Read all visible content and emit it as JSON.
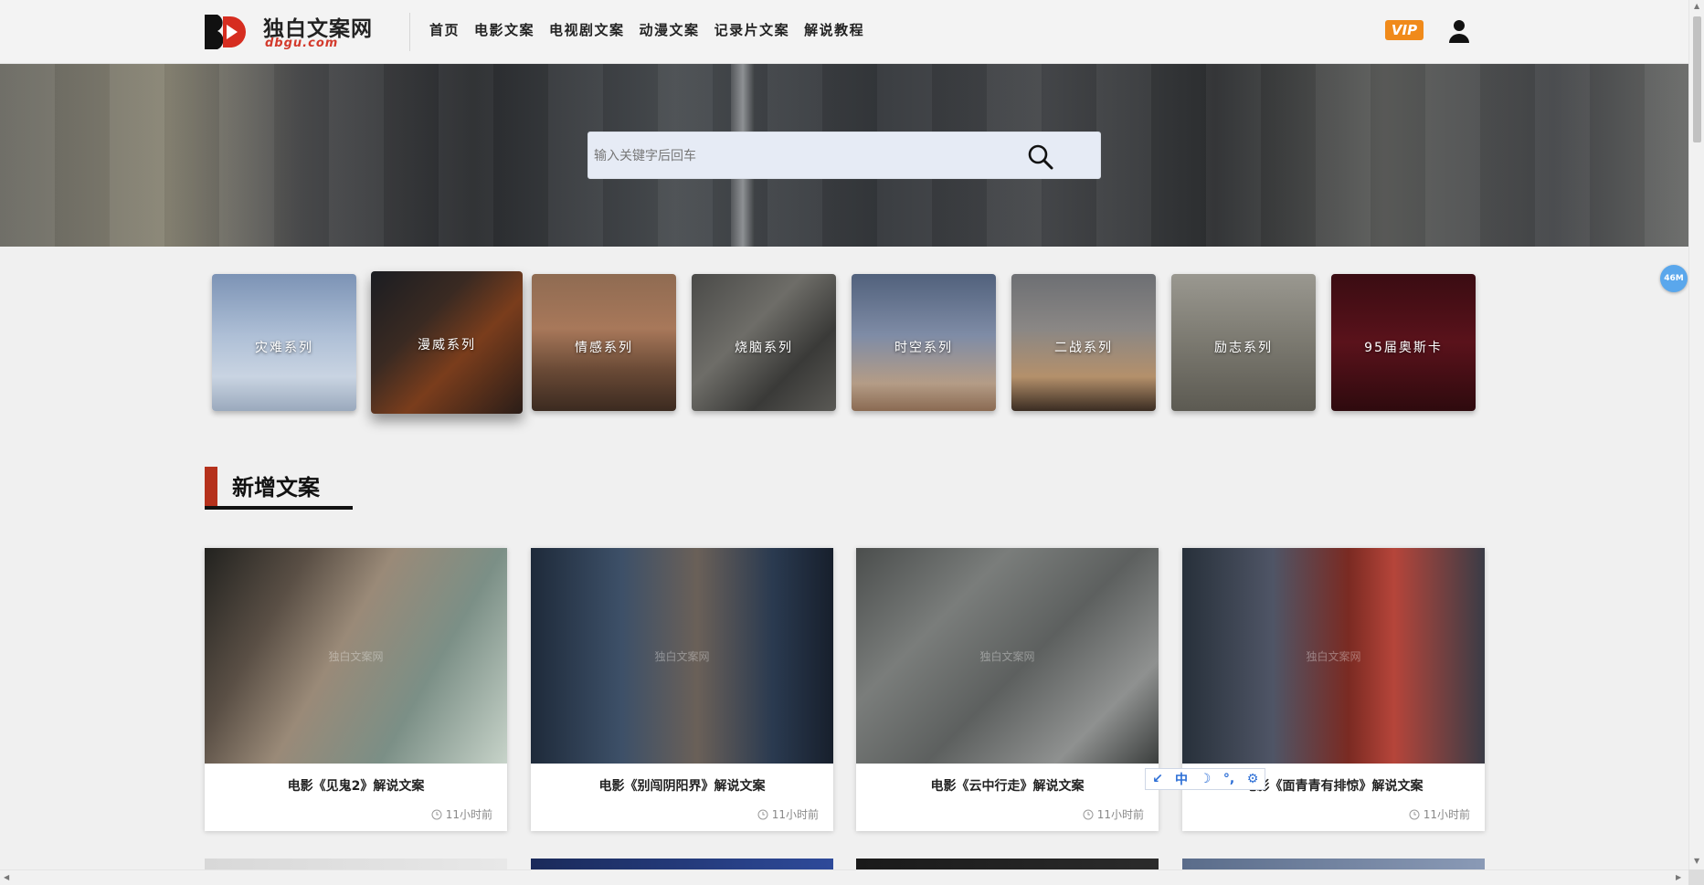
{
  "brand": {
    "name": "独白文案网",
    "domain": "dbgu.com"
  },
  "nav": {
    "items": [
      "首页",
      "电影文案",
      "电视剧文案",
      "动漫文案",
      "记录片文案",
      "解说教程"
    ]
  },
  "header": {
    "vip_label": "VIP"
  },
  "search": {
    "placeholder": "输入关键字后回车"
  },
  "categories": [
    {
      "label": "灾难系列",
      "bg": "linear-gradient(180deg,#7c93b5 0%,#aebfd6 45%,#c9d4e2 75%,#9aa9bd 100%)"
    },
    {
      "label": "漫威系列",
      "bg": "linear-gradient(135deg,#1b1d22 0%,#3a2a22 35%,#7a3d1c 60%,#2a1d18 100%)"
    },
    {
      "label": "情感系列",
      "bg": "linear-gradient(180deg,#8f6b52 0%,#a8785a 40%,#6a4a36 70%,#3b2a20 100%)"
    },
    {
      "label": "烧脑系列",
      "bg": "linear-gradient(135deg,#4a4a48 0%,#6e6d68 40%,#3a3a38 70%,#5a5955 100%)"
    },
    {
      "label": "时空系列",
      "bg": "linear-gradient(180deg,#51617c 0%,#7f8ca6 45%,#b49c86 80%,#8a6a52 100%)"
    },
    {
      "label": "二战系列",
      "bg": "linear-gradient(180deg,#6d6f73 0%,#8a8785 40%,#b4906b 75%,#3a2c22 100%)"
    },
    {
      "label": "励志系列",
      "bg": "linear-gradient(180deg,#9a9890 0%,#7b7970 50%,#5c5a52 100%)"
    },
    {
      "label": "95届奥斯卡",
      "bg": "linear-gradient(180deg,#3a0c12 0%,#5a121b 50%,#2e0a0e 100%)"
    }
  ],
  "section": {
    "title": "新增文案"
  },
  "articles": [
    {
      "title": "电影《见鬼2》解说文案",
      "time": "11小时前",
      "bg": "linear-gradient(120deg,#22221f 0%,#5a4f45 25%,#9a8a78 45%,#7b8f86 70%,#c7d3c9 100%)"
    },
    {
      "title": "电影《别闯阴阳界》解说文案",
      "time": "11小时前",
      "bg": "linear-gradient(90deg,#1e2a3a 0%,#3d5068 30%,#6a6058 55%,#2a3a50 80%,#171f2c 100%)"
    },
    {
      "title": "电影《云中行走》解说文案",
      "time": "11小时前",
      "bg": "linear-gradient(135deg,#4b4e4d 0%,#7a7d7b 30%,#5d605f 55%,#8f9190 80%,#3b3e3d 100%)"
    },
    {
      "title": "电影《面青青有排惊》解说文案",
      "time": "11小时前",
      "bg": "linear-gradient(90deg,#27303a 0%,#4f5566 30%,#7a2a22 55%,#b6453a 70%,#3a3c46 100%)"
    }
  ],
  "articles_row2": [
    {
      "bg": "linear-gradient(90deg,#d8d8d8,#e8e8e8)"
    },
    {
      "bg": "linear-gradient(90deg,#1a2a5a,#2e4a9a)"
    },
    {
      "bg": "linear-gradient(90deg,#1a1a1a,#2b2b2b)"
    },
    {
      "bg": "linear-gradient(90deg,#5a6c8a,#8a9ab6)"
    }
  ],
  "watermark": "独白文案网",
  "ime": {
    "items": [
      "↙",
      "中",
      "☽",
      "°,",
      "⚙"
    ]
  },
  "float_badge": "46M",
  "colors": {
    "accent_red": "#b5311c",
    "vip_orange": "#f08a1a",
    "badge_blue": "#5aa7ec",
    "ime_blue": "#2d6fd6"
  }
}
